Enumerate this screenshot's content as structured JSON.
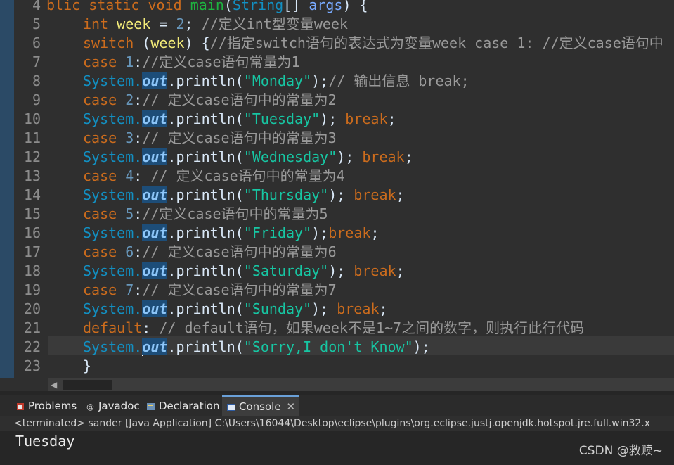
{
  "editor": {
    "lines": [
      {
        "n": "4"
      },
      {
        "n": "5"
      },
      {
        "n": "6"
      },
      {
        "n": "7"
      },
      {
        "n": "8"
      },
      {
        "n": "9"
      },
      {
        "n": "10"
      },
      {
        "n": "11"
      },
      {
        "n": "12"
      },
      {
        "n": "13"
      },
      {
        "n": "14"
      },
      {
        "n": "15"
      },
      {
        "n": "16"
      },
      {
        "n": "17"
      },
      {
        "n": "18"
      },
      {
        "n": "19"
      },
      {
        "n": "20"
      },
      {
        "n": "21"
      },
      {
        "n": "22"
      },
      {
        "n": "23"
      }
    ],
    "code": {
      "l4": {
        "a": "blic static void ",
        "b": "main",
        "c": "(",
        "d": "String",
        "e": "[] ",
        "f": "args",
        "g": ") {"
      },
      "l5": {
        "a": "int ",
        "b": "week",
        "c": " = ",
        "d": "2",
        "e": "; ",
        "f": "//定义int型变量week"
      },
      "l6": {
        "a": "switch ",
        "b": "(",
        "c": "week",
        "d": ") {",
        "e": "//指定switch语句的表达式为变量week case 1: //定义case语句中"
      },
      "l7": {
        "a": "case ",
        "b": "1",
        "c": ":",
        "d": "//定义case语句常量为1"
      },
      "l8": {
        "a": "System.",
        "b": "out",
        "c": ".println(",
        "d": "\"Monday\"",
        "e": ");",
        "f": "// 输出信息 break;"
      },
      "l9": {
        "a": "case ",
        "b": "2",
        "c": ":",
        "d": "// 定义case语句中的常量为2"
      },
      "l10": {
        "a": "System.",
        "b": "out",
        "c": ".println(",
        "d": "\"Tuesday\"",
        "e": "); ",
        "f": "break",
        ";": ";"
      },
      "l11": {
        "a": "case ",
        "b": "3",
        "c": ":",
        "d": "// 定义case语句中的常量为3"
      },
      "l12": {
        "a": "System.",
        "b": "out",
        "c": ".println(",
        "d": "\"Wednesday\"",
        "e": "); ",
        "f": "break",
        "g": ";"
      },
      "l13": {
        "a": "case ",
        "b": "4",
        "c": ": ",
        "d": "// 定义case语句中的常量为4"
      },
      "l14": {
        "a": "System.",
        "b": "out",
        "c": ".println(",
        "d": "\"Thursday\"",
        "e": "); ",
        "f": "break",
        "g": ";"
      },
      "l15": {
        "a": "case ",
        "b": "5",
        "c": ":",
        "d": "//定义case语句中的常量为5"
      },
      "l16": {
        "a": "System.",
        "b": "out",
        "c": ".println(",
        "d": "\"Friday\"",
        "e": ");",
        "f": "break",
        "g": ";"
      },
      "l17": {
        "a": "case ",
        "b": "6",
        "c": ":",
        "d": "// 定义case语句中的常量为6"
      },
      "l18": {
        "a": "System.",
        "b": "out",
        "c": ".println(",
        "d": "\"Saturday\"",
        "e": "); ",
        "f": "break",
        "g": ";"
      },
      "l19": {
        "a": "case ",
        "b": "7",
        "c": ":",
        "d": "// 定义case语句中的常量为7"
      },
      "l20": {
        "a": "System.",
        "b": "out",
        "c": ".println(",
        "d": "\"Sunday\"",
        "e": "); ",
        "f": "break",
        "g": ";"
      },
      "l21": {
        "a": "default",
        "b": ": ",
        "c": "// default语句，如果week不是1~7之间的数字，则执行此行代码"
      },
      "l22": {
        "a": "System.",
        "b": "out",
        "c": ".println(",
        "d": "\"Sorry,I don't Know\"",
        "e": ");"
      },
      "l23": {
        "a": "}"
      }
    }
  },
  "tabs": [
    {
      "label": "Problems",
      "icon": "problems-icon"
    },
    {
      "label": "Javadoc",
      "icon": "javadoc-icon"
    },
    {
      "label": "Declaration",
      "icon": "declaration-icon"
    },
    {
      "label": "Console",
      "icon": "console-icon"
    }
  ],
  "console": {
    "title": "<terminated> sander [Java Application] C:\\Users\\16044\\Desktop\\eclipse\\plugins\\org.eclipse.justj.openjdk.hotspot.jre.full.win32.x",
    "output": "Tuesday"
  },
  "watermark": "CSDN @救赎~",
  "colors": {
    "keyword": "#cc6c1d",
    "string": "#17c6a3",
    "class": "#1290c3",
    "comment": "#9a9a9a",
    "variable": "#f3ec79"
  }
}
